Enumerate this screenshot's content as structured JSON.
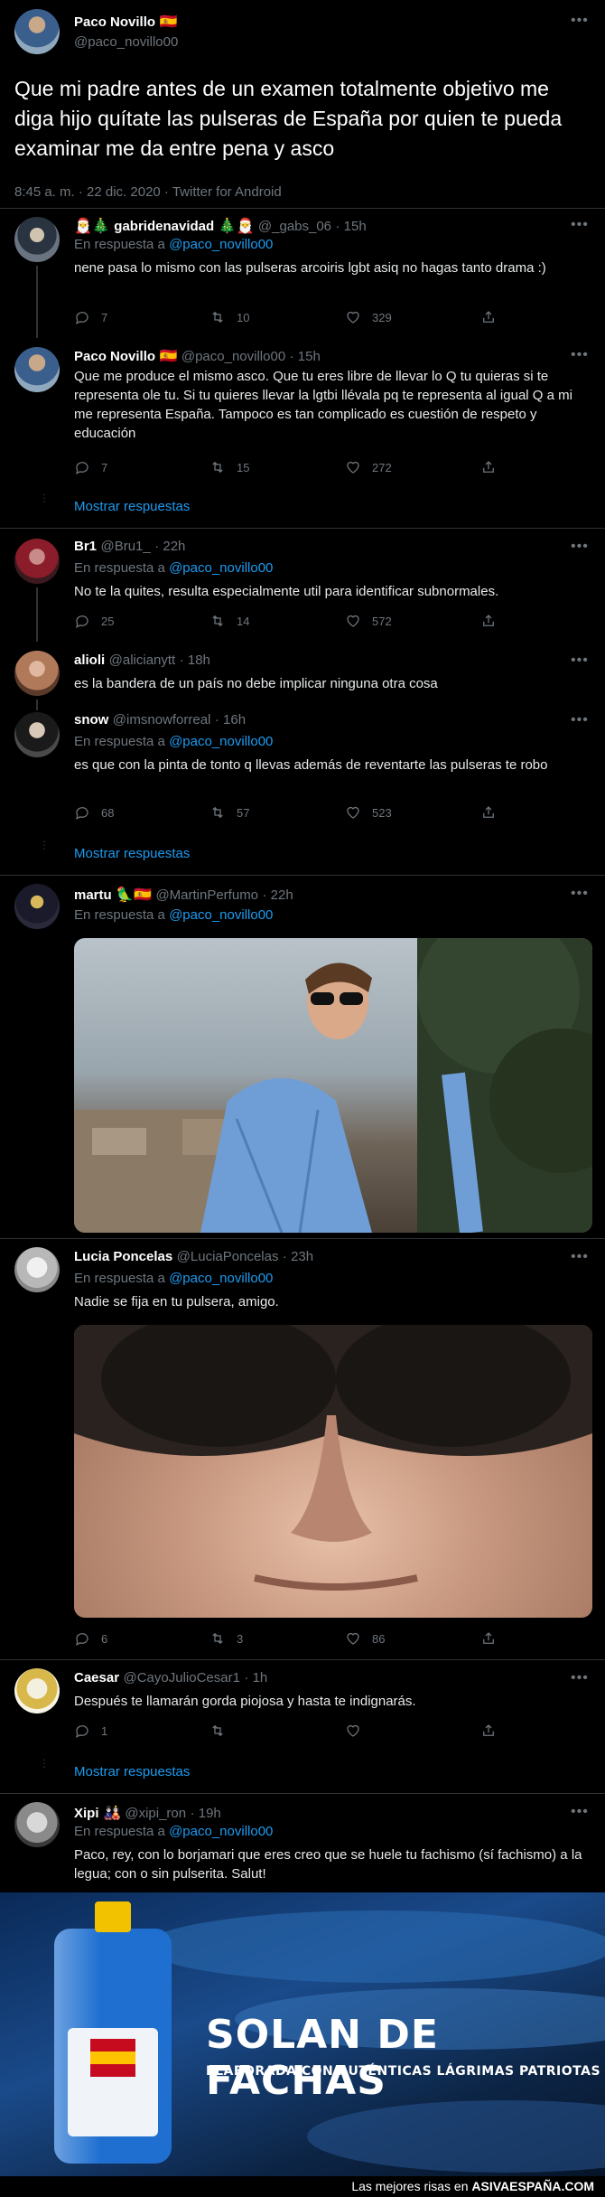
{
  "main_tweet": {
    "name": "Paco Novillo",
    "name_flag": "🇪🇸",
    "handle": "@paco_novillo00",
    "text": "Que mi padre antes de un examen totalmente objetivo me diga hijo quítate las pulseras de España por quien te pueda examinar me da entre pena y asco",
    "meta": "8:45 a. m. · 22 dic. 2020 · Twitter for Android"
  },
  "replies": [
    {
      "name": "gabridenavidad",
      "name_prefix": "🎅🎄",
      "name_suffix": "🎄🎅",
      "handle": "@_gabs_06",
      "time": "· 15h",
      "reply_label": "En respuesta a",
      "mention": "@paco_novillo00",
      "text": "nene pasa lo mismo con las pulseras arcoiris lgbt asiq no hagas tanto drama :)",
      "replies": "7",
      "retweets": "10",
      "likes": "329"
    },
    {
      "name": "Paco Novillo",
      "name_suffix": "🇪🇸",
      "handle": "@paco_novillo00",
      "time": "· 15h",
      "text": "Que me produce el mismo asco. Que tu eres libre de llevar lo Q tu quieras si te representa ole tu. Si tu quieres llevar la lgtbi llévala pq te representa al igual Q a mi me representa España. Tampoco es tan complicado es cuestión de respeto y educación",
      "replies": "7",
      "retweets": "15",
      "likes": "272"
    },
    {
      "name": "Br1",
      "handle": "@Bru1_",
      "time": "· 22h",
      "reply_label": "En respuesta a",
      "mention": "@paco_novillo00",
      "text": "No te la quites, resulta especialmente util para identificar subnormales.",
      "replies": "25",
      "retweets": "14",
      "likes": "572"
    },
    {
      "name": "alioli",
      "handle": "@alicianytt",
      "time": "· 18h",
      "text": "es la bandera de un país no debe implicar ninguna otra cosa"
    },
    {
      "name": "snow",
      "handle": "@imsnowforreal",
      "time": "· 16h",
      "reply_label": "En respuesta a",
      "mention": "@paco_novillo00",
      "text": "es que con la pinta de tonto q llevas además de reventarte las pulseras te robo",
      "replies": "68",
      "retweets": "57",
      "likes": "523"
    },
    {
      "name": "martu",
      "name_suffix": "🦜🇪🇸",
      "handle": "@MartinPerfumo",
      "time": "· 22h",
      "reply_label": "En respuesta a",
      "mention": "@paco_novillo00"
    },
    {
      "name": "Lucia Poncelas",
      "handle": "@LuciaPoncelas",
      "time": "· 23h",
      "reply_label": "En respuesta a",
      "mention": "@paco_novillo00",
      "text": "Nadie se fija en tu pulsera, amigo.",
      "replies": "6",
      "retweets": "3",
      "likes": "86"
    },
    {
      "name": "Caesar",
      "handle": "@CayoJulioCesar1",
      "time": "· 1h",
      "text": "Después te llamarán gorda piojosa y hasta te indignarás.",
      "replies": "1"
    },
    {
      "name": "Xipi",
      "name_suffix": "🎎",
      "handle": "@xipi_ron",
      "time": "· 19h",
      "reply_label": "En respuesta a",
      "mention": "@paco_novillo00",
      "text": "Paco, rey, con lo borjamari que eres creo que se huele tu fachismo (sí fachismo) a la legua; con o sin pulserita. Salut!"
    }
  ],
  "show_replies_label": "Mostrar respuestas",
  "ad": {
    "title": "SOLAN DE FACHAS",
    "subtitle": "ELABORADA CON AUTÉNTICAS LÁGRIMAS PATRIOTAS"
  },
  "footer": {
    "prefix": "Las mejores risas en",
    "site": "ASIVAESPAÑA.COM"
  },
  "colors": {
    "link": "#1d9bf0",
    "muted": "#6e767d",
    "border": "#2f3336",
    "background": "#000000"
  }
}
